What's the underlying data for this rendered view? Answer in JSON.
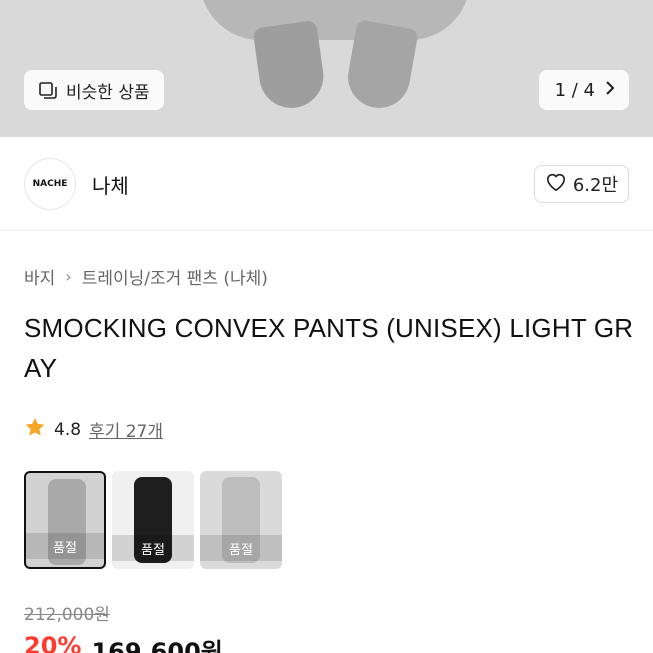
{
  "gallery": {
    "similar_label": "비슷한 상품",
    "pager": "1 / 4"
  },
  "brand": {
    "logo_text": "NACHE",
    "name": "나체",
    "likes": "6.2만"
  },
  "breadcrumb": [
    "바지",
    "트레이닝/조거 팬츠 (나체)"
  ],
  "product": {
    "title": "SMOCKING CONVEX PANTS (UNISEX) LIGHT GRAY",
    "rating": "4.8",
    "reviews": "후기 27개"
  },
  "swatches": [
    {
      "label": "품절",
      "color": "#a9a9a9"
    },
    {
      "label": "품절",
      "color": "#1e1e1e"
    },
    {
      "label": "품절",
      "color": "#bdbdbd"
    }
  ],
  "price": {
    "original": "212,000원",
    "discount": "20%",
    "sale": "169,600원"
  },
  "colors": {
    "discount": "#ff3b30",
    "star": "#f5a623"
  }
}
